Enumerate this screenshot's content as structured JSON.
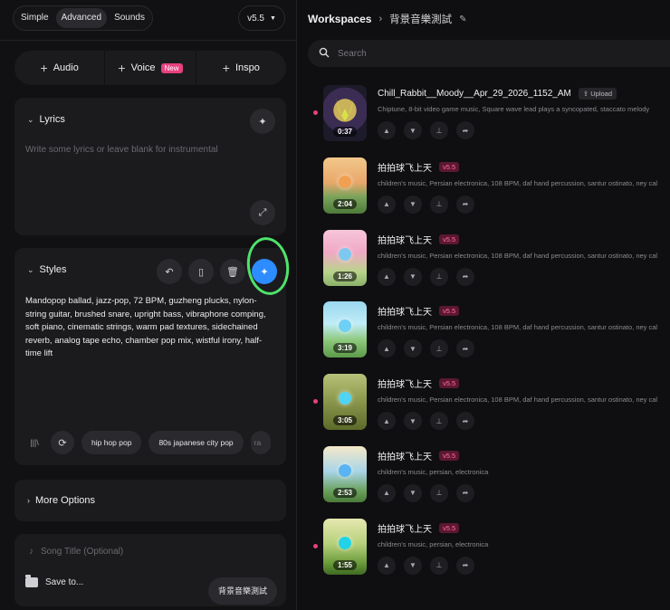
{
  "mode_tabs": [
    "Simple",
    "Advanced",
    "Sounds"
  ],
  "active_mode": "Advanced",
  "version_select": "v5.5",
  "add_buttons": {
    "audio": "Audio",
    "voice": "Voice",
    "voice_badge": "New",
    "inspo": "Inspo"
  },
  "lyrics": {
    "title": "Lyrics",
    "placeholder": "Write some lyrics or leave blank for instrumental"
  },
  "styles": {
    "title": "Styles",
    "text": "Mandopop ballad, jazz-pop, 72 BPM, guzheng plucks, nylon-string guitar, brushed snare, upright bass, vibraphone comping, soft piano, cinematic strings, warm pad textures, sidechained reverb, analog tape echo, chamber pop mix, wistful irony, half-time lift",
    "tags": [
      "hip hop pop",
      "80s japanese city pop",
      "ra"
    ]
  },
  "more_options": "More Options",
  "song_title_placeholder": "Song Title (Optional)",
  "save_to": {
    "label": "Save to...",
    "workspace": "背景音樂測試"
  },
  "breadcrumb": {
    "root": "Workspaces",
    "current": "背景音樂測試"
  },
  "search_placeholder": "Search",
  "songs": [
    {
      "title": "Chill_Rabbit__Moody__Apr_29_2026_1152_AM",
      "badge": "Upload",
      "badge_kind": "upload",
      "desc": "Chiptune, 8-bit video game music, Square wave lead plays a syncopated, staccato melody",
      "duration": "0:37",
      "dot": true,
      "art": "rabbit"
    },
    {
      "title": "拍拍球飞上天",
      "badge": "v5.5",
      "badge_kind": "version",
      "desc": "children's music, Persian electronica, 108 BPM, daf hand percussion, santur ostinato, ney cal",
      "duration": "2:04",
      "dot": false,
      "art": "ball1"
    },
    {
      "title": "拍拍球飞上天",
      "badge": "v5.5",
      "badge_kind": "version",
      "desc": "children's music, Persian electronica, 108 BPM, daf hand percussion, santur ostinato, ney cal",
      "duration": "1:26",
      "dot": false,
      "art": "ball2"
    },
    {
      "title": "拍拍球飞上天",
      "badge": "v5.5",
      "badge_kind": "version",
      "desc": "children's music, Persian electronica, 108 BPM, daf hand percussion, santur ostinato, ney cal",
      "duration": "3:19",
      "dot": false,
      "art": "ball3"
    },
    {
      "title": "拍拍球飞上天",
      "badge": "v5.5",
      "badge_kind": "version",
      "desc": "children's music, Persian electronica, 108 BPM, daf hand percussion, santur ostinato, ney cal",
      "duration": "3:05",
      "dot": true,
      "art": "ball4"
    },
    {
      "title": "拍拍球飞上天",
      "badge": "v5.5",
      "badge_kind": "version",
      "desc": "children's music, persian, electronica",
      "duration": "2:53",
      "dot": false,
      "art": "ball5"
    },
    {
      "title": "拍拍球飞上天",
      "badge": "v5.5",
      "badge_kind": "version",
      "desc": "children's music, persian, electronica",
      "duration": "1:55",
      "dot": true,
      "art": "ball6"
    }
  ],
  "song_actions": [
    "thumbs-up-icon",
    "thumbs-down-icon",
    "pin-icon",
    "share-icon"
  ],
  "colors": {
    "accent_pink": "#e8407f",
    "active_blue": "#2d8cff",
    "highlight_green": "#4ee36b"
  }
}
